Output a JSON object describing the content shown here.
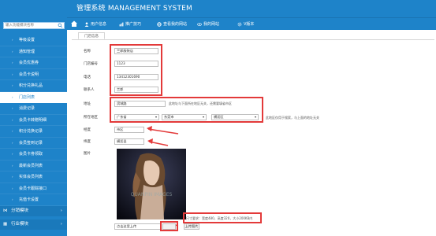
{
  "app": {
    "title": "管理系统 MANAGEMENT SYSTEM"
  },
  "sidebar": {
    "search_placeholder": "输入功能模块名称",
    "items": [
      {
        "label": "等级设置"
      },
      {
        "label": "通知管理"
      },
      {
        "label": "会员优惠券"
      },
      {
        "label": "会员卡说明"
      },
      {
        "label": "积分兑换礼品"
      },
      {
        "label": "门店列表"
      },
      {
        "label": "消费记录"
      },
      {
        "label": "会员卡转赠明细"
      },
      {
        "label": "积分兑换记录"
      },
      {
        "label": "会员签到记录"
      },
      {
        "label": "会员卡劵领取"
      },
      {
        "label": "最新会员列表"
      },
      {
        "label": "实体会员列表"
      },
      {
        "label": "会员卡跟踪接口"
      },
      {
        "label": "充值卡设置"
      }
    ],
    "groups": [
      {
        "label": "分销模块"
      },
      {
        "label": "行业模块"
      }
    ]
  },
  "nav": {
    "items": [
      {
        "label": "用户信息"
      },
      {
        "label": "推广技巧"
      },
      {
        "label": "查看我的网站"
      },
      {
        "label": "我的网站"
      },
      {
        "label": "V版本"
      }
    ]
  },
  "tab": {
    "label": "门店信息"
  },
  "form": {
    "name_label": "名称",
    "name_value": "兰郎服装店",
    "number_label": "门店编号",
    "number_value": "1123",
    "phone_label": "电话",
    "phone_value": "13412301690",
    "contact_label": "联系人",
    "contact_value": "兰郎",
    "address_label": "地址",
    "address_value": "滨城路",
    "address_hint": "此地址与下面所在地区无关，还需要填省市区",
    "region_label": "所在地区",
    "province": "广东省",
    "city": "东莞市",
    "district": "横沥区",
    "region_hint": "此地区仅用于搜索，与上面的地址无关",
    "longitude_label": "经度",
    "longitude_value": "市区",
    "latitude_label": "纬度",
    "latitude_value": "横沥县",
    "image_label": "图片",
    "photo_watermark": "QUANPIN IMAGES",
    "upload_label": "点击这里上传",
    "upload_hint": "尺寸要求：宽度480，高度320，大小200KB内",
    "upload_button": "上传图片"
  },
  "colors": {
    "brand": "#1e83c9",
    "annotation": "#e33a3a"
  }
}
